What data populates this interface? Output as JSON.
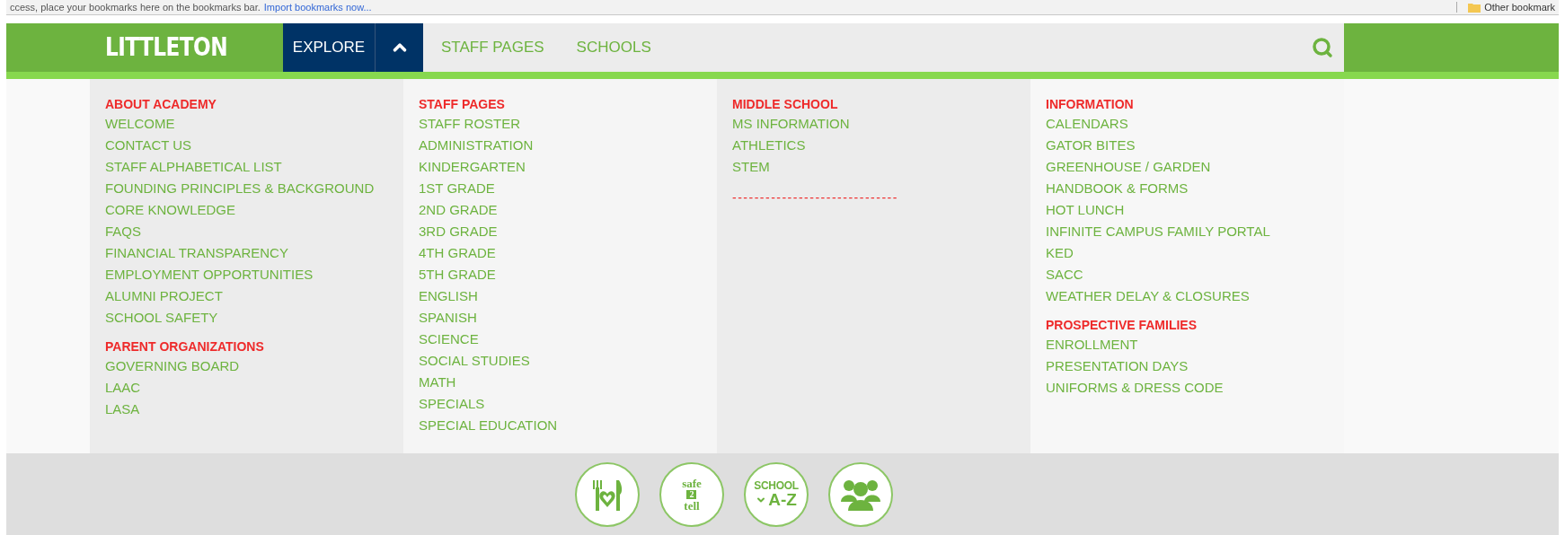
{
  "bookmarks_bar": {
    "message": "ccess, place your bookmarks here on the bookmarks bar.",
    "import_link": "Import bookmarks now...",
    "other_bookmarks": "Other bookmark"
  },
  "nav": {
    "logo": "LITTLETON",
    "explore": {
      "label": "EXPLORE",
      "expanded": true
    },
    "links": [
      "STAFF PAGES",
      "SCHOOLS"
    ]
  },
  "menu": {
    "columns": [
      {
        "sections": [
          {
            "heading": "ABOUT ACADEMY",
            "items": [
              "WELCOME",
              "CONTACT US",
              "STAFF ALPHABETICAL LIST",
              "FOUNDING PRINCIPLES & BACKGROUND",
              "CORE KNOWLEDGE",
              "FAQS",
              "FINANCIAL TRANSPARENCY",
              "EMPLOYMENT OPPORTUNITIES",
              "ALUMNI PROJECT",
              "SCHOOL SAFETY"
            ]
          },
          {
            "heading": "PARENT ORGANIZATIONS",
            "items": [
              "GOVERNING BOARD",
              "LAAC",
              "LASA"
            ]
          }
        ]
      },
      {
        "sections": [
          {
            "heading": "STAFF PAGES",
            "items": [
              "STAFF ROSTER",
              "ADMINISTRATION",
              "KINDERGARTEN",
              "1ST GRADE",
              "2ND GRADE",
              "3RD GRADE",
              "4TH GRADE",
              "5TH GRADE",
              "ENGLISH",
              "SPANISH",
              "SCIENCE",
              "SOCIAL STUDIES",
              "MATH",
              "SPECIALS",
              "SPECIAL EDUCATION"
            ]
          }
        ]
      },
      {
        "sections": [
          {
            "heading": "MIDDLE SCHOOL",
            "items": [
              "MS INFORMATION",
              "ATHLETICS",
              "STEM"
            ],
            "rule": "------------------------------"
          }
        ]
      },
      {
        "sections": [
          {
            "heading": "INFORMATION",
            "items": [
              "CALENDARS",
              "GATOR BITES",
              "GREENHOUSE / GARDEN",
              "HANDBOOK & FORMS",
              "HOT LUNCH",
              "INFINITE CAMPUS FAMILY PORTAL",
              "KED",
              "SACC",
              "WEATHER DELAY & CLOSURES"
            ]
          },
          {
            "heading": "PROSPECTIVE FAMILIES",
            "items": [
              "ENROLLMENT",
              "PRESENTATION DAYS",
              "UNIFORMS & DRESS CODE"
            ]
          }
        ]
      }
    ]
  },
  "footer_badges": [
    {
      "kind": "lunch"
    },
    {
      "kind": "safe2tell",
      "lines": [
        "safe",
        "2",
        "tell"
      ]
    },
    {
      "kind": "az",
      "lines": [
        "SCHOOL",
        "A-Z"
      ]
    },
    {
      "kind": "people"
    }
  ]
}
